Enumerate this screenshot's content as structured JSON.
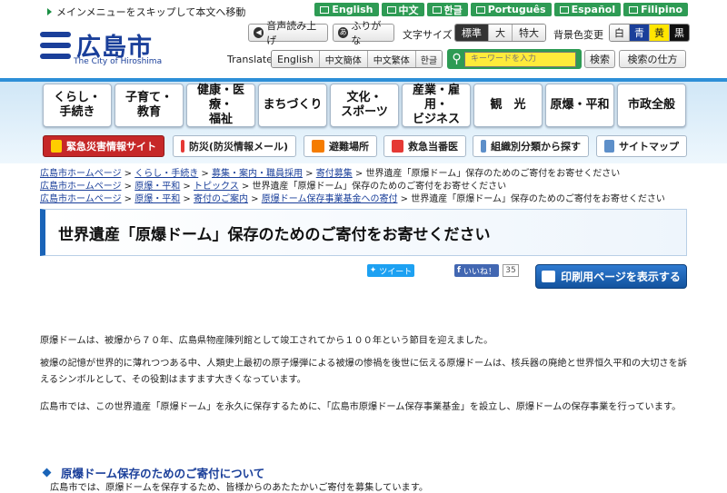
{
  "header": {
    "skip_link": "メインメニューをスキップして本文へ移動",
    "languages": [
      "English",
      "中文",
      "한글",
      "Português",
      "Español",
      "Filipino"
    ],
    "logo_text": "広島市",
    "logo_en": "The City of Hiroshima",
    "read_aloud": "音声読み上げ",
    "furigana": "ふりがな",
    "font_size_label": "文字サイズ",
    "font_sizes": [
      "標準",
      "大",
      "特大"
    ],
    "bg_color_label": "背景色変更",
    "bg_colors": [
      "白",
      "青",
      "黄",
      "黒"
    ],
    "translate_label": "Translate",
    "translate_options": [
      "English",
      "中文簡体",
      "中文繁体",
      "한글"
    ],
    "search_placeholder": "キーワードを入力",
    "search_button": "検索",
    "search_howto": "検索の仕方"
  },
  "nav": {
    "items": [
      "くらし・\n手続き",
      "子育て・\n教育",
      "健康・医療・\n福祉",
      "まちづくり",
      "文化・\nスポーツ",
      "産業・雇用・\nビジネス",
      "観　光",
      "原爆・平和",
      "市政全般"
    ],
    "quick": [
      "緊急災害情報サイト",
      "防災(防災情報メール)",
      "避難場所",
      "救急当番医",
      "組織別分類から探す",
      "サイトマップ"
    ]
  },
  "breadcrumbs": [
    [
      "広島市ホームページ",
      "くらし・手続き",
      "募集・案内・職員採用",
      "寄付募集",
      "世界遺産「原爆ドーム」保存のためのご寄付をお寄せください"
    ],
    [
      "広島市ホームページ",
      "原爆・平和",
      "トピックス",
      "世界遺産「原爆ドーム」保存のためのご寄付をお寄せください"
    ],
    [
      "広島市ホームページ",
      "原爆・平和",
      "寄付のご案内",
      "原爆ドーム保存事業基金への寄付",
      "世界遺産「原爆ドーム」保存のためのご寄付をお寄せください"
    ]
  ],
  "page": {
    "title": "世界遺産「原爆ドーム」保存のためのご寄付をお寄せください",
    "tweet": "ツイート",
    "like": "いいね！",
    "like_count": "35",
    "print_button": "印刷用ページを表示する",
    "paragraphs": [
      "原爆ドームは、被爆から７０年、広島県物産陳列館として竣工されてから１００年という節目を迎えました。",
      "被爆の記憶が世界的に薄れつつある中、人類史上最初の原子爆弾による被爆の惨禍を後世に伝える原爆ドームは、核兵器の廃絶と世界恒久平和の大切さを訴えるシンボルとして、その役割はますます大きくなっています。",
      "広島市では、この世界遺産「原爆ドーム」を永久に保存するために、「広島市原爆ドーム保存事業基金」を設立し、原爆ドームの保存事業を行っています。"
    ],
    "section_title": "原爆ドーム保存のためのご寄付について",
    "section_text": "広島市では、原爆ドームを保存するため、皆様からのあたたかいご寄付を募集しています。"
  },
  "colors": {
    "brand": "#1a3f9a",
    "green": "#2e9b54",
    "accent_blue": "#2d8fd7"
  }
}
